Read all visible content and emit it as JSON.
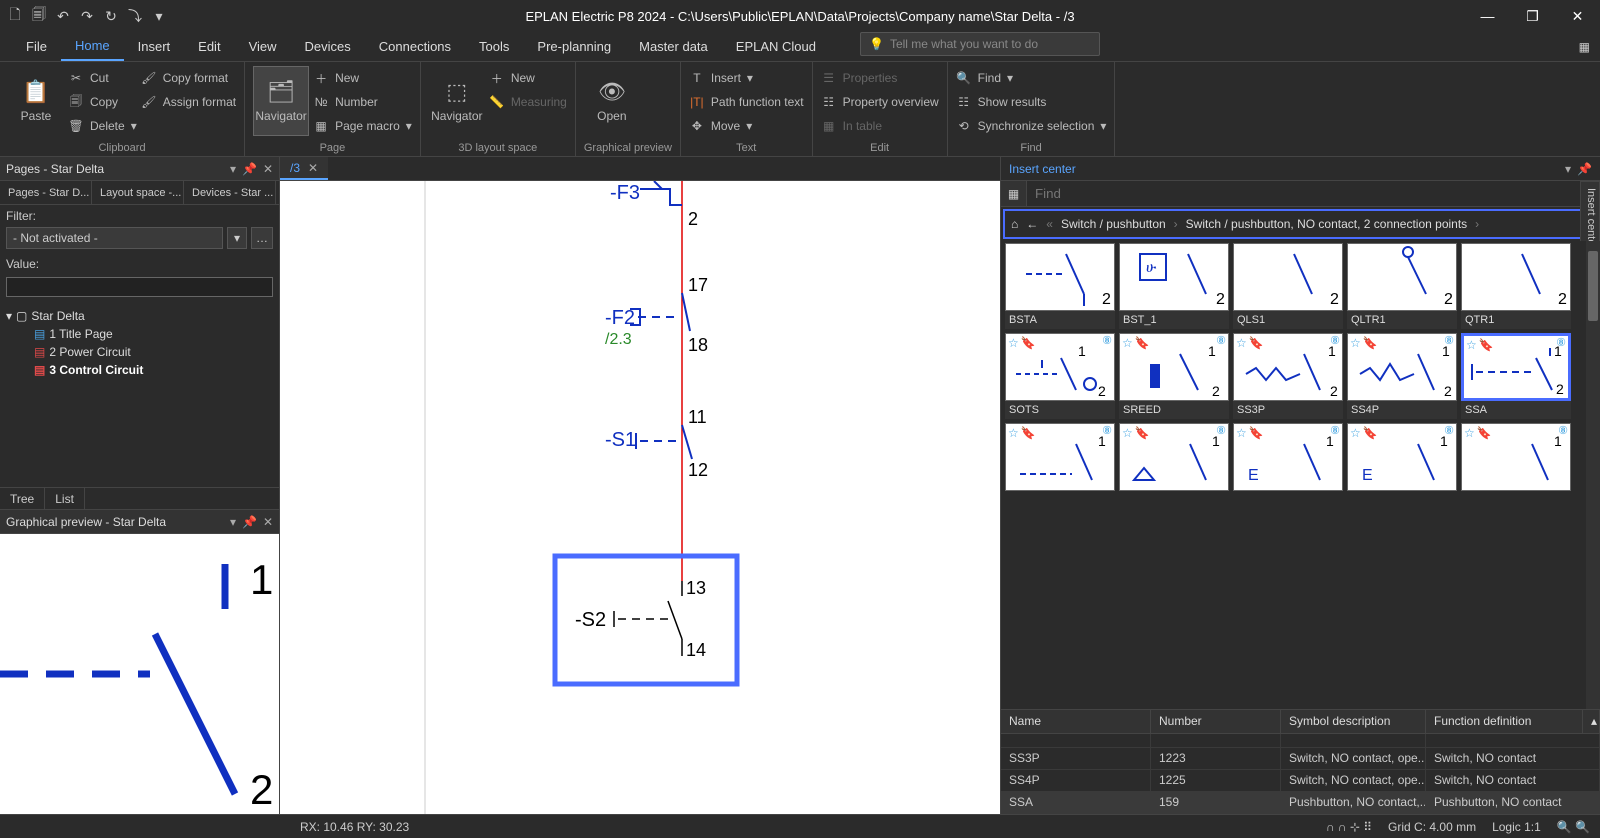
{
  "title": "EPLAN Electric P8 2024 - C:\\Users\\Public\\EPLAN\\Data\\Projects\\Company name\\Star Delta - /3",
  "menu": [
    "File",
    "Home",
    "Insert",
    "Edit",
    "View",
    "Devices",
    "Connections",
    "Tools",
    "Pre-planning",
    "Master data",
    "EPLAN Cloud"
  ],
  "menu_active": 1,
  "search_placeholder": "Tell me what you want to do",
  "ribbon": {
    "clipboard": {
      "label": "Clipboard",
      "paste": "Paste",
      "cut": "Cut",
      "copy": "Copy",
      "delete": "Delete",
      "copy_format": "Copy format",
      "assign_format": "Assign format"
    },
    "page": {
      "label": "Page",
      "navigator": "Navigator",
      "new": "New",
      "number": "Number",
      "page_macro": "Page macro"
    },
    "layout": {
      "label": "3D layout space",
      "navigator": "Navigator",
      "new": "New",
      "measuring": "Measuring"
    },
    "graphical": {
      "label": "Graphical preview",
      "open": "Open"
    },
    "text": {
      "label": "Text",
      "insert": "Insert",
      "path_fn": "Path function text",
      "move": "Move"
    },
    "edit": {
      "label": "Edit",
      "properties": "Properties",
      "overview": "Property overview",
      "in_table": "In table"
    },
    "find": {
      "label": "Find",
      "find": "Find",
      "results": "Show results",
      "sync": "Synchronize selection"
    }
  },
  "pages_panel": {
    "title": "Pages - Star Delta",
    "tabs": [
      "Pages - Star D...",
      "Layout space -...",
      "Devices - Star ..."
    ],
    "filter_label": "Filter:",
    "filter_value": "- Not activated -",
    "value_label": "Value:",
    "root": "Star Delta",
    "items": [
      {
        "label": "1 Title Page",
        "bold": false
      },
      {
        "label": "2 Power Circuit",
        "bold": false
      },
      {
        "label": "3 Control Circuit",
        "bold": true
      }
    ],
    "subtabs": [
      "Tree",
      "List"
    ]
  },
  "preview_panel": {
    "title": "Graphical preview - Star Delta",
    "pin1": "1",
    "pin2": "2"
  },
  "center": {
    "tab": "/3",
    "schem": {
      "f3": "-F3",
      "f3_pin": "2",
      "f2": "-F2",
      "f2_xref": "/2.3",
      "f2_p1": "17",
      "f2_p2": "18",
      "s1": "-S1",
      "s1_p1": "11",
      "s1_p2": "12",
      "s2": "-S2",
      "s2_p1": "13",
      "s2_p2": "14"
    }
  },
  "insert_center": {
    "title": "Insert center",
    "side_tab": "Insert center",
    "find_placeholder": "Find",
    "breadcrumb": [
      "Switch / pushbutton",
      "Switch / pushbutton, NO contact, 2 connection points"
    ],
    "row1": [
      "BSTA",
      "BST_1",
      "QLS1",
      "QLTR1",
      "QTR1"
    ],
    "row2": [
      "SOTS",
      "SREED",
      "SS3P",
      "SS4P",
      "SSA"
    ],
    "row2_selected": 4,
    "row3_visible": true,
    "table": {
      "headers": [
        "Name",
        "Number",
        "Symbol description",
        "Function definition"
      ],
      "rows": [
        {
          "name": "SS3P",
          "number": "1223",
          "desc": "Switch, NO contact, ope...",
          "func": "Switch, NO contact"
        },
        {
          "name": "SS4P",
          "number": "1225",
          "desc": "Switch, NO contact, ope...",
          "func": "Switch, NO contact"
        },
        {
          "name": "SSA",
          "number": "159",
          "desc": "Pushbutton, NO contact,...",
          "func": "Pushbutton, NO contact",
          "selected": true
        }
      ]
    }
  },
  "status": {
    "coords": "RX: 10.46 RY: 30.23",
    "grid": "Grid C: 4.00 mm",
    "logic": "Logic 1:1"
  }
}
